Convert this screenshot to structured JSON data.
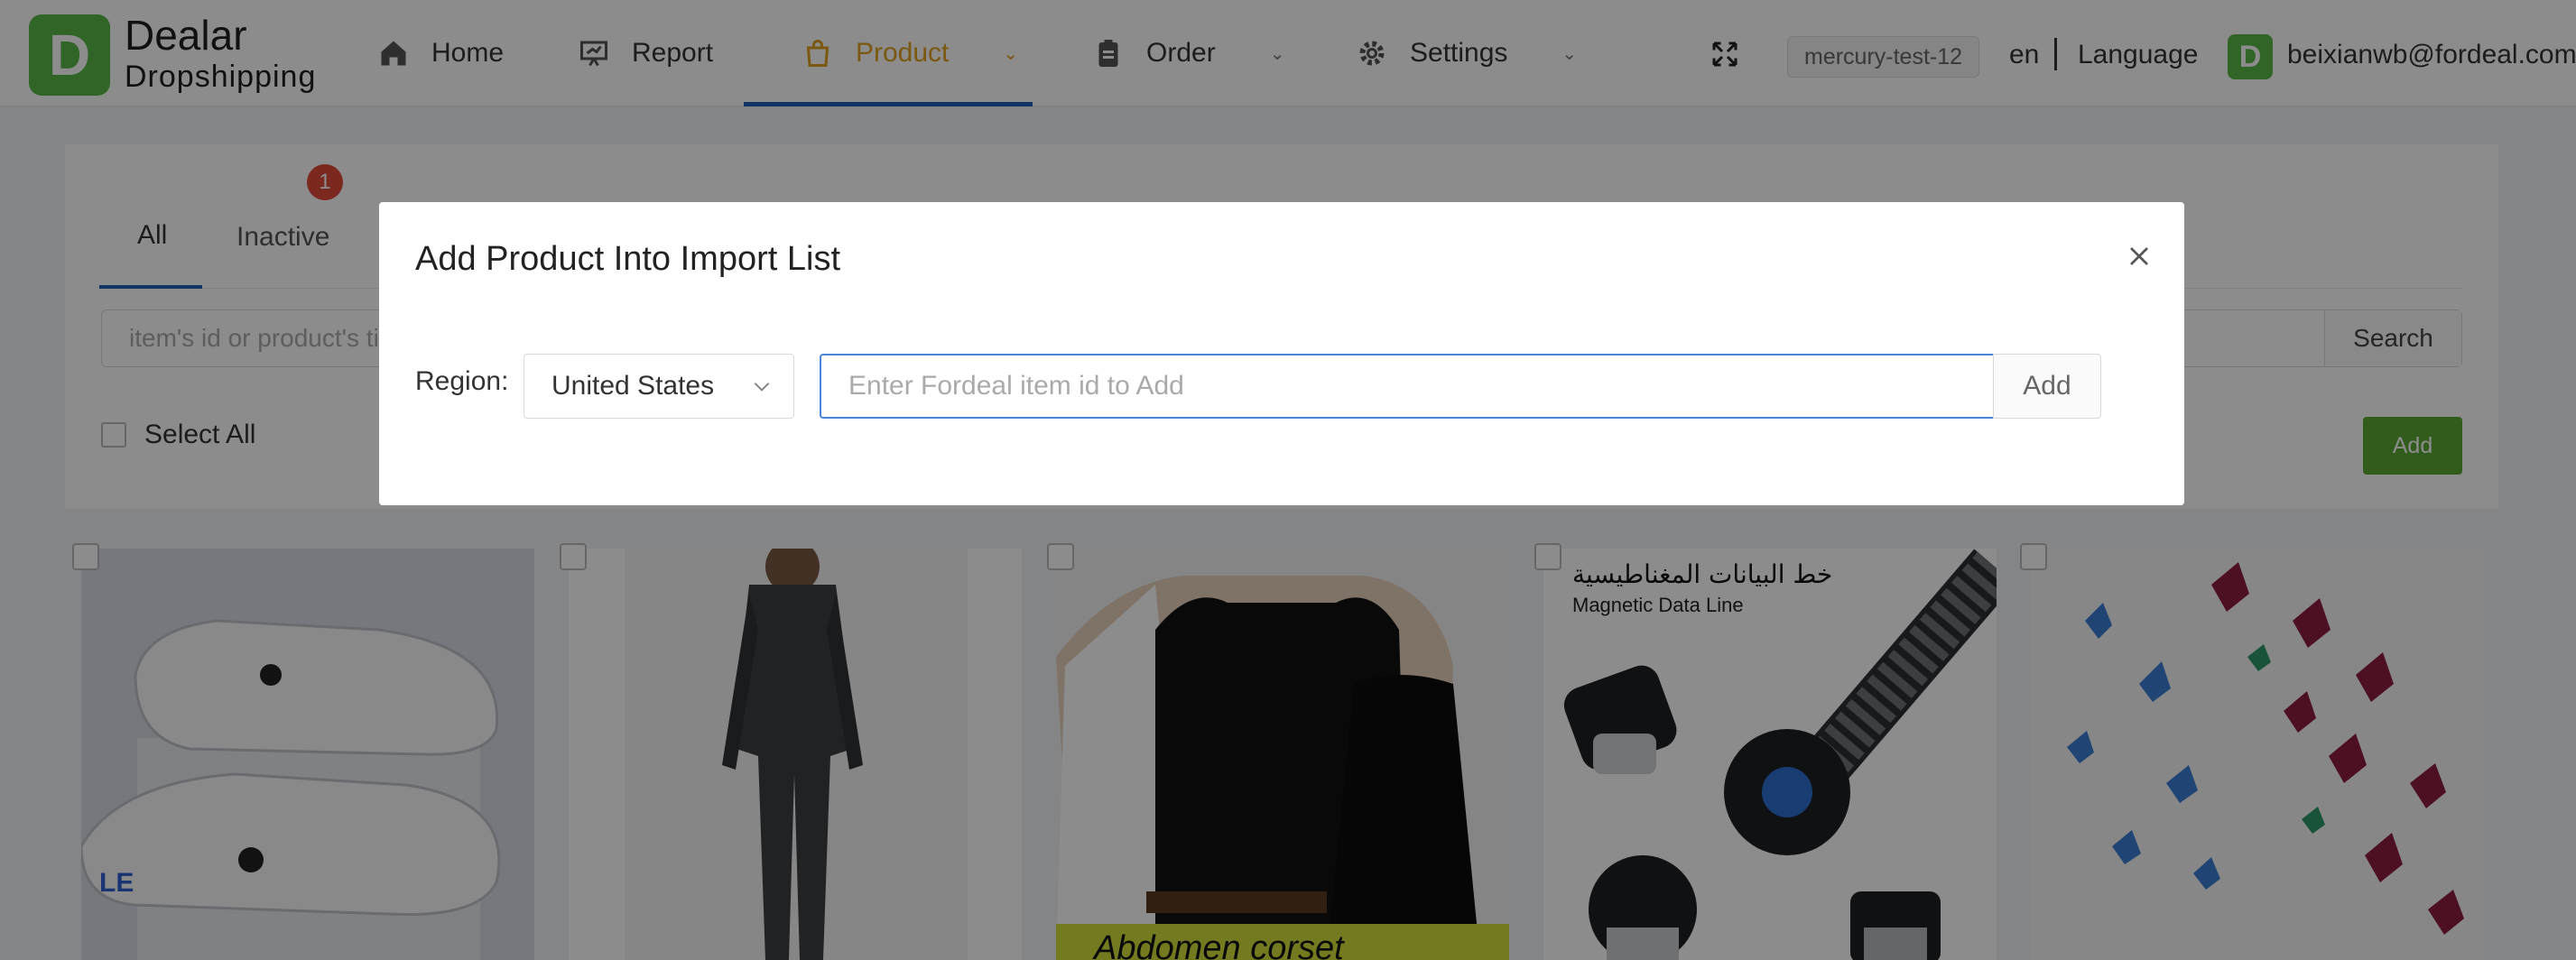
{
  "header": {
    "brand_line1": "Dealar",
    "brand_line2": "Dropshipping",
    "logo_letter": "D",
    "nav": {
      "home": "Home",
      "report": "Report",
      "product": "Product",
      "order": "Order",
      "settings": "Settings"
    },
    "store": "mercury-test-12",
    "lang_code": "en",
    "lang_label": "Language",
    "avatar_letter": "D",
    "user_email": "beixianwb@fordeal.com"
  },
  "colors": {
    "brand_green": "#58b848",
    "active_nav": "#e0a11c",
    "tab_underline": "#1f5fb8",
    "add_button": "#59a832",
    "badge_red": "#e04a3a"
  },
  "panel": {
    "tabs": {
      "all": "All",
      "inactive": "Inactive",
      "inactive_badge": "1"
    },
    "search_placeholder": "item's id or product's title",
    "search_button": "Search",
    "select_all": "Select All",
    "add_button": "Add"
  },
  "products": {
    "card4_text_ar": "خط البيانات المغناطيسية",
    "card4_text_en": "Magnetic Data Line",
    "card3_text": "Abdomen corset"
  },
  "modal": {
    "title": "Add Product Into Import List",
    "region_label": "Region:",
    "region_value": "United States",
    "item_placeholder": "Enter Fordeal item id to Add",
    "add_button": "Add"
  }
}
